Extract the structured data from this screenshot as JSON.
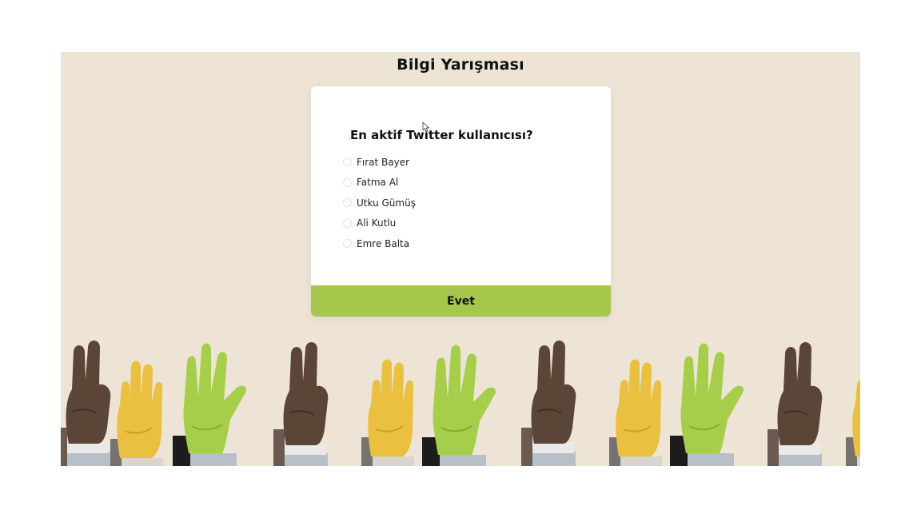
{
  "page": {
    "title": "Bilgi Yarışması"
  },
  "quiz": {
    "question": "En aktif Twitter kullanıcısı?",
    "answers": [
      {
        "label": "Fırat Bayer"
      },
      {
        "label": "Fatma Al"
      },
      {
        "label": "Utku Gümüş"
      },
      {
        "label": "Ali Kutlu"
      },
      {
        "label": "Emre Balta"
      }
    ],
    "submit_label": "Evet"
  },
  "colors": {
    "background": "#ede4d6",
    "card": "#ffffff",
    "submit_button": "#a6c64c",
    "hand_dark": "#5b4536",
    "hand_yellow": "#e9c040",
    "hand_green": "#a7ce4a"
  },
  "decoration": {
    "illustration": "row-of-raised-hands-illustration",
    "cursor_icon": "mouse-pointer-icon"
  }
}
